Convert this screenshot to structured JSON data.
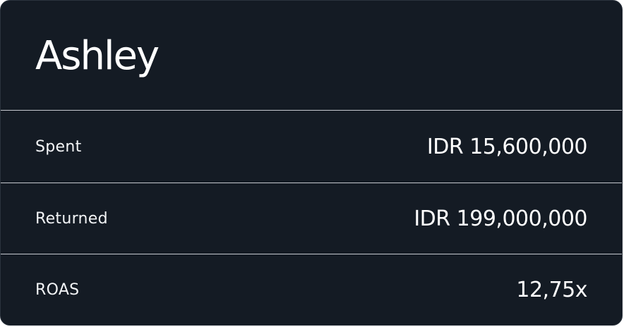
{
  "card": {
    "title": "Ashley",
    "rows": [
      {
        "label": "Spent",
        "value": "IDR 15,600,000"
      },
      {
        "label": "Returned",
        "value": "IDR 199,000,000"
      },
      {
        "label": "ROAS",
        "value": "12,75x"
      }
    ]
  },
  "colors": {
    "background": "#141b24",
    "text": "#ffffff",
    "divider": "#d9dde2"
  }
}
